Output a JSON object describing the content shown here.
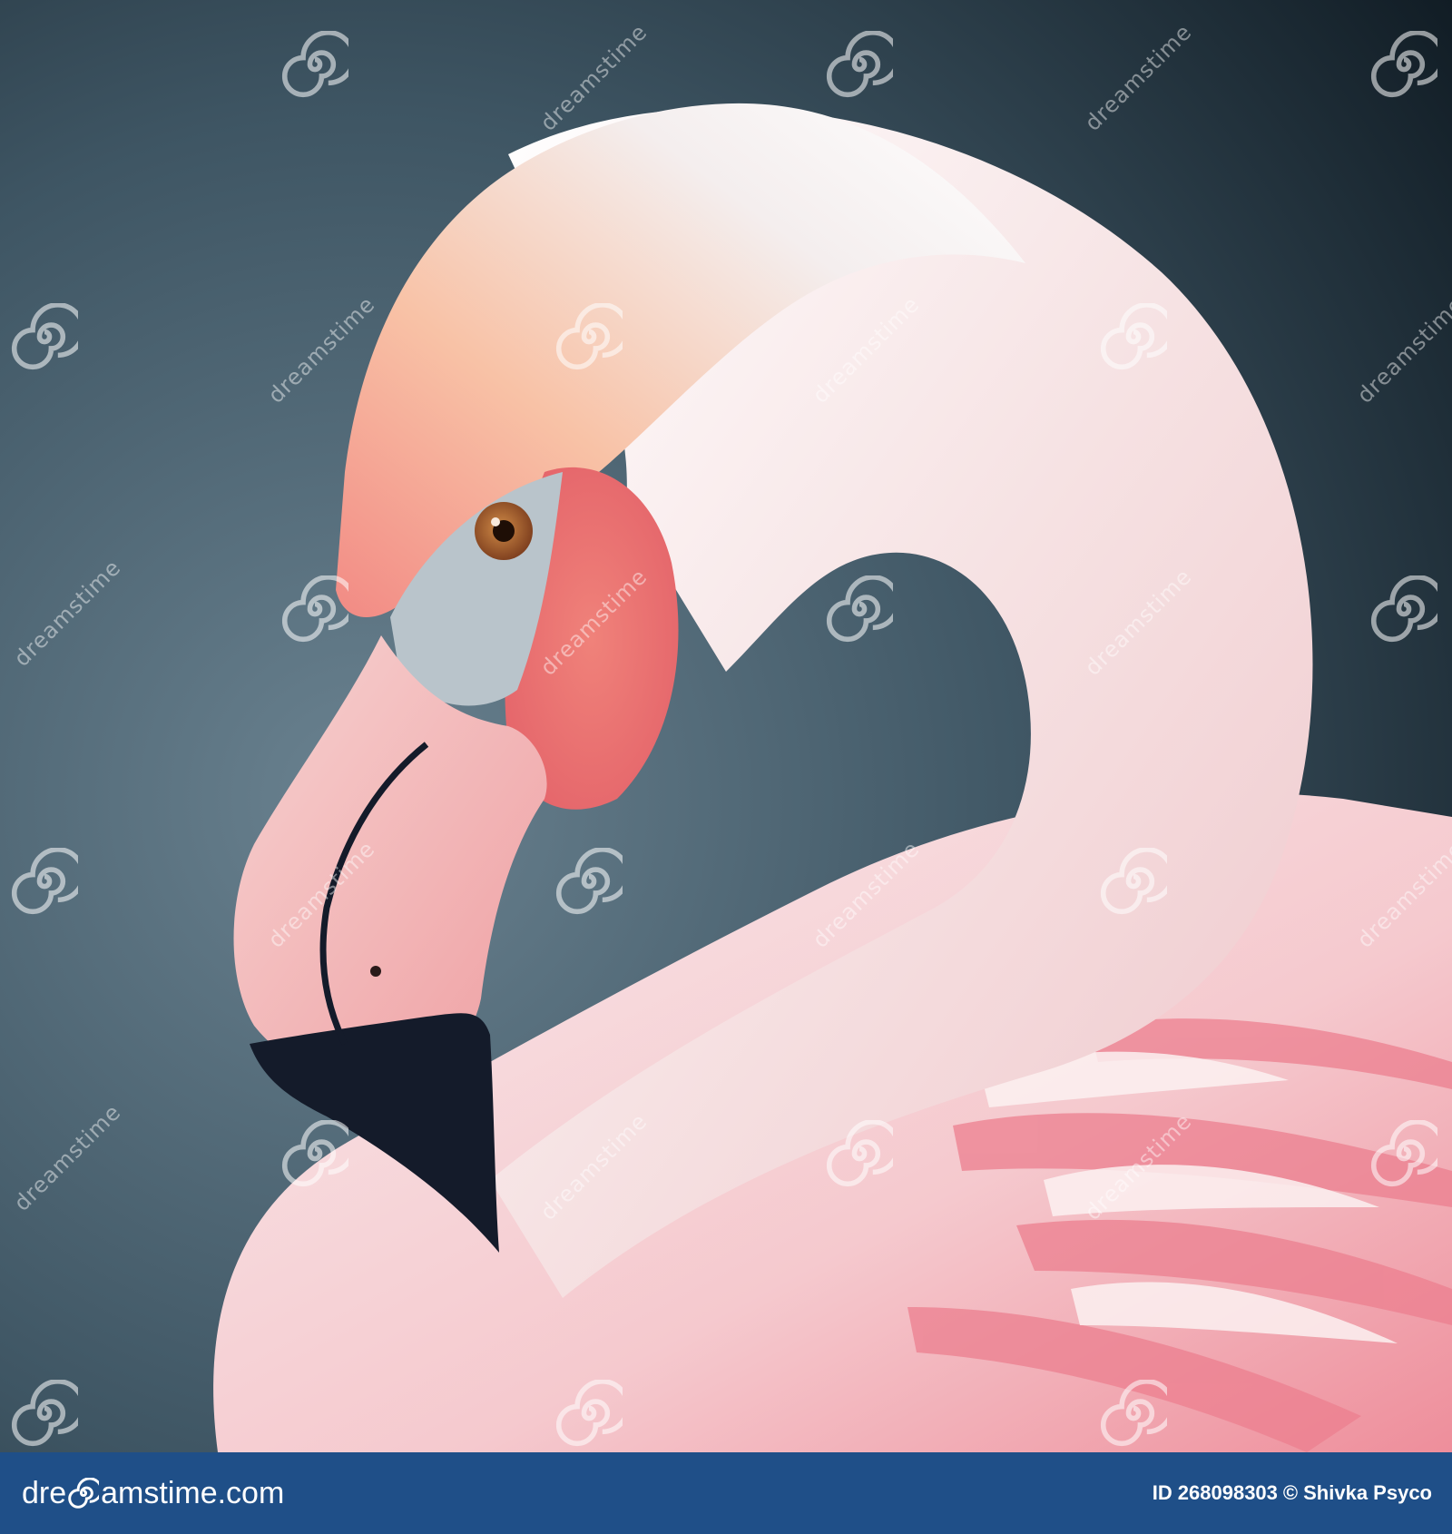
{
  "image": {
    "subject": "flamingo",
    "colors": {
      "background_light": "#5e7684",
      "background_dark": "#0f1a22",
      "plumage": "#f6d9db",
      "plumage_pink": "#ef8d9a",
      "face": "#ee7f7a",
      "beak_pink": "#f3b6b6",
      "beak_tip": "#141b2a",
      "eye": "#b56a2e"
    }
  },
  "watermark": {
    "text": "dreamstime",
    "icon": "spiral-logo-icon"
  },
  "footer": {
    "brand_prefix": "dre",
    "brand_suffix": "amstime.com",
    "brand_icon": "spiral-logo-icon",
    "id_label": "ID",
    "id_value": "268098303",
    "copyright_symbol": "©",
    "author": "Shivka Psyco",
    "background_color": "#1f4f88"
  }
}
